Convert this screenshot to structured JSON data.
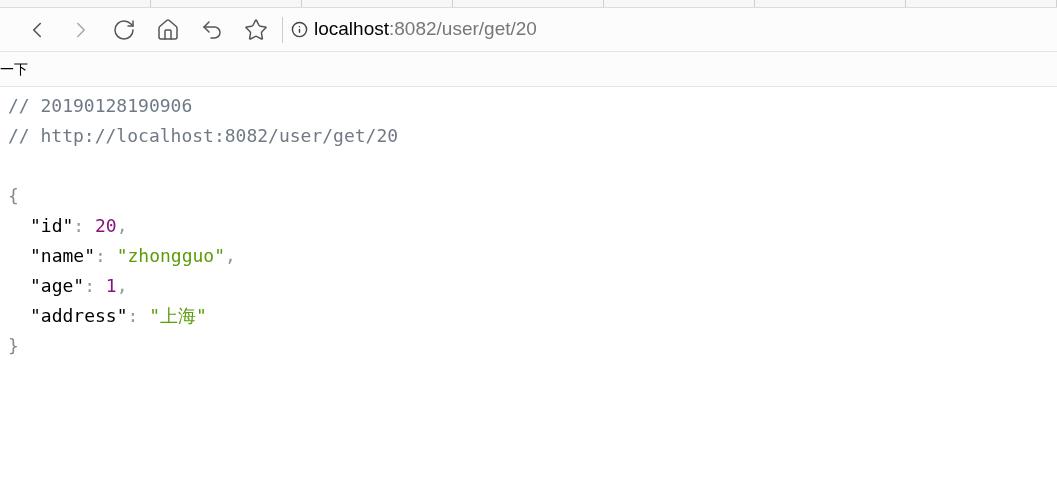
{
  "toolbar": {
    "url_host": "localhost",
    "url_rest": ":8082/user/get/20"
  },
  "bookmarks": [
    {
      "label": "一下"
    }
  ],
  "json_view": {
    "comments": [
      "// 20190128190906",
      "// http://localhost:8082/user/get/20"
    ],
    "open_brace": "{",
    "fields": [
      {
        "key": "\"id\"",
        "colon": ":",
        "value": "20",
        "kind": "number",
        "comma": ","
      },
      {
        "key": "\"name\"",
        "colon": ":",
        "value": "\"zhongguo\"",
        "kind": "string",
        "comma": ","
      },
      {
        "key": "\"age\"",
        "colon": ":",
        "value": "1",
        "kind": "number",
        "comma": ","
      },
      {
        "key": "\"address\"",
        "colon": ":",
        "value": "\"上海\"",
        "kind": "string"
      }
    ],
    "close_brace": "}"
  }
}
